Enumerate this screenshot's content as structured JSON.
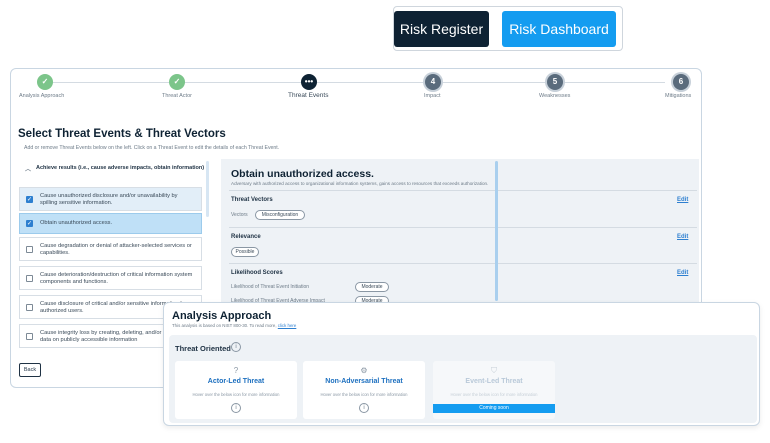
{
  "top_buttons": {
    "risk_register": "Risk Register",
    "risk_dashboard": "Risk Dashboard"
  },
  "stepper": {
    "steps": [
      {
        "label": "Analysis Approach",
        "badge": "✓",
        "state": "done"
      },
      {
        "label": "Threat Actor",
        "badge": "✓",
        "state": "done"
      },
      {
        "label": "Threat Events",
        "badge": "•••",
        "state": "current"
      },
      {
        "label": "Impact",
        "badge": "4",
        "state": "todo"
      },
      {
        "label": "Weaknesses",
        "badge": "5",
        "state": "todo"
      },
      {
        "label": "Mitigations",
        "badge": "6",
        "state": "todo"
      }
    ]
  },
  "page": {
    "title": "Select Threat Events & Threat Vectors",
    "subtitle": "Add or remove Threat Events below on the left. Click on a Threat Event to edit the details of each Threat Event."
  },
  "event_list": {
    "group_title": "Achieve results (i.e., cause adverse impacts, obtain information)",
    "items": [
      {
        "text": "Cause unauthorized disclosure and/or unavailability by spilling sensitive information.",
        "checked": true
      },
      {
        "text": "Obtain unauthorized access.",
        "checked": true
      },
      {
        "text": "Cause degradation or denial of attacker-selected services or capabilities.",
        "checked": false
      },
      {
        "text": "Cause deterioration/destruction of critical information system components and functions.",
        "checked": false
      },
      {
        "text": "Cause disclosure of critical and/or sensitive information by authorized users.",
        "checked": false
      },
      {
        "text": "Cause integrity loss by creating, deleting, and/or modifying data on publicly accessible information",
        "checked": false
      }
    ],
    "back_label": "Back"
  },
  "detail": {
    "title": "Obtain unauthorized access.",
    "description": "Adversary with authorized access to organizational information systems, gains access to resources that exceeds authorization.",
    "vectors_heading": "Threat Vectors",
    "vectors_label": "Vectors",
    "vector_pill": "Misconfiguration",
    "relevance_heading": "Relevance",
    "relevance_pill": "Possible",
    "likelihood_heading": "Likelihood Scores",
    "initiation_label": "Likelihood of Threat Event Initiation",
    "initiation_value": "Moderate",
    "adverse_label": "Likelihood of Threat Event Adverse Impact",
    "adverse_value": "Moderate",
    "edit_label": "Edit"
  },
  "overlay": {
    "title": "Analysis Approach",
    "note_prefix": "This analysis is based on NIST 800-30. To read more,",
    "note_link": "click here",
    "section_label": "Threat Oriented",
    "cards": [
      {
        "title": "Actor-Led Threat",
        "sub": "Hover over the below icon for more information",
        "disabled": false
      },
      {
        "title": "Non-Adversarial Threat",
        "sub": "Hover over the below icon for more information",
        "disabled": false
      },
      {
        "title": "Event-Led Threat",
        "sub": "Hover over the below icon for more information",
        "disabled": true,
        "badge": "Coming soon"
      }
    ]
  },
  "colors": {
    "navy": "#0e2233",
    "accent_blue": "#149cf0",
    "done_green": "#7cc58a",
    "link_blue": "#2d7fd0"
  }
}
